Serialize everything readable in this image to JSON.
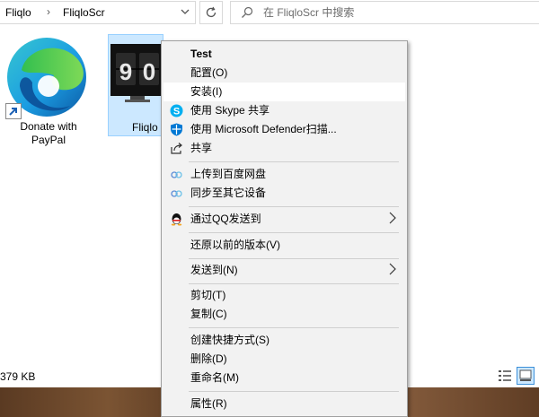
{
  "window": {
    "breadcrumbs": [
      "Fliqlo",
      "FliqloScr"
    ],
    "search_placeholder": "在 FliqloScr 中搜索"
  },
  "files": [
    {
      "name_line1": "Donate with",
      "name_line2": "PayPal",
      "icon": "edge-shortcut-icon"
    },
    {
      "name": "Fliqlo",
      "icon": "fliqlo-clock-icon",
      "clock_digits": "9 0"
    }
  ],
  "status": {
    "size": "379 KB"
  },
  "context_menu": {
    "items": [
      {
        "label": "Test",
        "bold": true
      },
      {
        "label": "配置(O)"
      },
      {
        "label": "安装(I)",
        "highlighted": true
      },
      {
        "label": "使用 Skype 共享",
        "icon": "skype-icon"
      },
      {
        "label": "使用 Microsoft Defender扫描...",
        "icon": "defender-shield-icon"
      },
      {
        "label": "共享",
        "icon": "share-icon"
      },
      {
        "label": "上传到百度网盘",
        "icon": "baidu-cloud-icon"
      },
      {
        "label": "同步至其它设备",
        "icon": "baidu-cloud-icon"
      },
      {
        "label": "通过QQ发送到",
        "icon": "qq-penguin-icon",
        "submenu": true
      },
      {
        "label": "还原以前的版本(V)"
      },
      {
        "label": "发送到(N)",
        "submenu": true
      },
      {
        "label": "剪切(T)"
      },
      {
        "label": "复制(C)"
      },
      {
        "label": "创建快捷方式(S)"
      },
      {
        "label": "删除(D)"
      },
      {
        "label": "重命名(M)"
      },
      {
        "label": "属性(R)"
      }
    ]
  },
  "colors": {
    "selection_bg": "#cce8ff",
    "selection_border": "#99d1ff",
    "menu_bg": "#f2f2f2",
    "menu_hover": "#ffffff",
    "skype_blue": "#00aff0",
    "defender_blue": "#0078d4"
  }
}
